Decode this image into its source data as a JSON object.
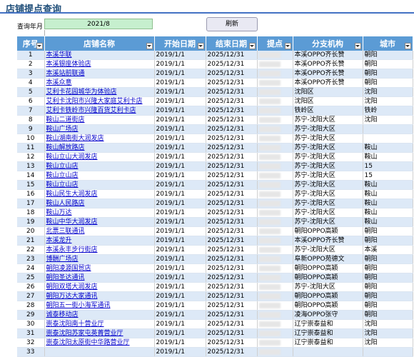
{
  "title": "店铺提点查询",
  "query": {
    "label": "查询年月",
    "value": "2021/8"
  },
  "refresh_label": "刷新",
  "columns": [
    "序号",
    "店铺名称",
    "开始日期",
    "结束日期",
    "提点",
    "分支机构",
    "城市"
  ],
  "rows": [
    {
      "no": "1",
      "name": "本溪华联",
      "start": "2019/1/1",
      "end": "2025/12/31",
      "branch": "本溪OPPO齐长赞",
      "city": "朝阳"
    },
    {
      "no": "2",
      "name": "本溪银座体验店",
      "start": "2019/1/1",
      "end": "2025/12/31",
      "branch": "本溪OPPO齐长赞",
      "city": "朝阳"
    },
    {
      "no": "3",
      "name": "本溪站前联通",
      "start": "2019/1/1",
      "end": "2025/12/31",
      "branch": "本溪OPPO齐长赞",
      "city": "朝阳"
    },
    {
      "no": "4",
      "name": "本溪众意",
      "start": "2019/1/1",
      "end": "2025/12/31",
      "branch": "本溪OPPO齐长赞",
      "city": "朝阳"
    },
    {
      "no": "5",
      "name": "艾利卡花园城华为体验店",
      "start": "2019/1/1",
      "end": "2025/12/31",
      "branch": "沈阳区",
      "city": "沈阳"
    },
    {
      "no": "6",
      "name": "艾利卡沈阳市兴隆大家庭艾利卡店",
      "start": "2019/1/1",
      "end": "2025/12/31",
      "branch": "沈阳区",
      "city": "沈阳"
    },
    {
      "no": "7",
      "name": "艾利卡铁岭市兴隆百货艾利卡店",
      "start": "2019/1/1",
      "end": "2025/12/31",
      "branch": "铁岭区",
      "city": "铁岭"
    },
    {
      "no": "8",
      "name": "鞍山二道街店",
      "start": "2019/1/1",
      "end": "2025/12/31",
      "branch": "苏宁-沈阳大区",
      "city": "沈阳"
    },
    {
      "no": "9",
      "name": "鞍山广场店",
      "start": "2019/1/1",
      "end": "2025/12/31",
      "branch": "苏宁-沈阳大区",
      "city": ""
    },
    {
      "no": "10",
      "name": "鞍山湖南街大润发店",
      "start": "2019/1/1",
      "end": "2025/12/31",
      "branch": "苏宁-沈阳大区",
      "city": ""
    },
    {
      "no": "11",
      "name": "鞍山解放路店",
      "start": "2019/1/1",
      "end": "2025/12/31",
      "branch": "苏宁-沈阳大区",
      "city": "鞍山"
    },
    {
      "no": "12",
      "name": "鞍山立山大润发店",
      "start": "2019/1/1",
      "end": "2025/12/31",
      "branch": "苏宁-沈阳大区",
      "city": "鞍山"
    },
    {
      "no": "13",
      "name": "鞍山立山店",
      "start": "2019/1/1",
      "end": "2025/12/31",
      "branch": "苏宁-沈阳大区",
      "city": "15"
    },
    {
      "no": "14",
      "name": "鞍山立山店",
      "start": "2019/1/1",
      "end": "2025/12/31",
      "branch": "苏宁-沈阳大区",
      "city": "15"
    },
    {
      "no": "15",
      "name": "鞍山立山店",
      "start": "2019/1/1",
      "end": "2025/12/31",
      "branch": "苏宁-沈阳大区",
      "city": "鞍山"
    },
    {
      "no": "16",
      "name": "鞍山民生大润发店",
      "start": "2019/1/1",
      "end": "2025/12/31",
      "branch": "苏宁-沈阳大区",
      "city": "鞍山"
    },
    {
      "no": "17",
      "name": "鞍山人民路店",
      "start": "2019/1/1",
      "end": "2025/12/31",
      "branch": "苏宁-沈阳大区",
      "city": "鞍山"
    },
    {
      "no": "18",
      "name": "鞍山万达",
      "start": "2019/1/1",
      "end": "2025/12/31",
      "branch": "苏宁-沈阳大区",
      "city": "鞍山"
    },
    {
      "no": "19",
      "name": "鞍山中华大润发店",
      "start": "2019/1/1",
      "end": "2025/12/31",
      "branch": "苏宁-沈阳大区",
      "city": "鞍山"
    },
    {
      "no": "20",
      "name": "北票三联通讯",
      "start": "2019/1/1",
      "end": "2025/12/31",
      "branch": "朝阳OPPO高颖",
      "city": "朝阳"
    },
    {
      "no": "21",
      "name": "本溪龙升",
      "start": "2019/1/1",
      "end": "2025/12/31",
      "branch": "本溪OPPO齐长赞",
      "city": "朝阳"
    },
    {
      "no": "22",
      "name": "本溪永丰步行街店",
      "start": "2019/1/1",
      "end": "2025/12/31",
      "branch": "苏宁-沈阳大区",
      "city": "本溪"
    },
    {
      "no": "23",
      "name": "博酬广场店",
      "start": "2019/1/1",
      "end": "2025/12/31",
      "branch": "阜新OPPO苑德文",
      "city": "朝阳"
    },
    {
      "no": "24",
      "name": "朝阳凌源国贸店",
      "start": "2019/1/1",
      "end": "2025/12/31",
      "branch": "朝阳OPPO高颖",
      "city": "朝阳"
    },
    {
      "no": "25",
      "name": "朝阳圣达通讯",
      "start": "2019/1/1",
      "end": "2025/12/31",
      "branch": "朝阳OPPO高颖",
      "city": "朝阳"
    },
    {
      "no": "26",
      "name": "朝阳双塔大润发店",
      "start": "2019/1/1",
      "end": "2025/12/31",
      "branch": "苏宁-沈阳大区",
      "city": "朝阳"
    },
    {
      "no": "27",
      "name": "朝阳万达大家通讯",
      "start": "2019/1/1",
      "end": "2025/12/31",
      "branch": "朝阳OPPO高颖",
      "city": "朝阳"
    },
    {
      "no": "28",
      "name": "朝阳五一街小海军通讯",
      "start": "2019/1/1",
      "end": "2025/12/31",
      "branch": "朝阳OPPO高颖",
      "city": "朝阳"
    },
    {
      "no": "29",
      "name": "诚泰移动店",
      "start": "2019/1/1",
      "end": "2025/12/31",
      "branch": "凌海OPPO张守",
      "city": "朝阳"
    },
    {
      "no": "30",
      "name": "崇泰沈阳南十营业厅",
      "start": "2019/1/1",
      "end": "2025/12/31",
      "branch": "辽宁崇泰益和",
      "city": "沈阳"
    },
    {
      "no": "31",
      "name": "崇泰沈阳苏家屯英菁营业厅",
      "start": "2019/1/1",
      "end": "2025/12/31",
      "branch": "辽宁崇泰益和",
      "city": "沈阳"
    },
    {
      "no": "32",
      "name": "崇泰沈阳太原街中华路营业厅",
      "start": "2019/1/1",
      "end": "2025/12/31",
      "branch": "辽宁崇泰益和",
      "city": "沈阳"
    },
    {
      "no": "33",
      "name": "",
      "start": "2019/1/1",
      "end": "2025/12/31",
      "branch": "",
      "city": ""
    }
  ]
}
